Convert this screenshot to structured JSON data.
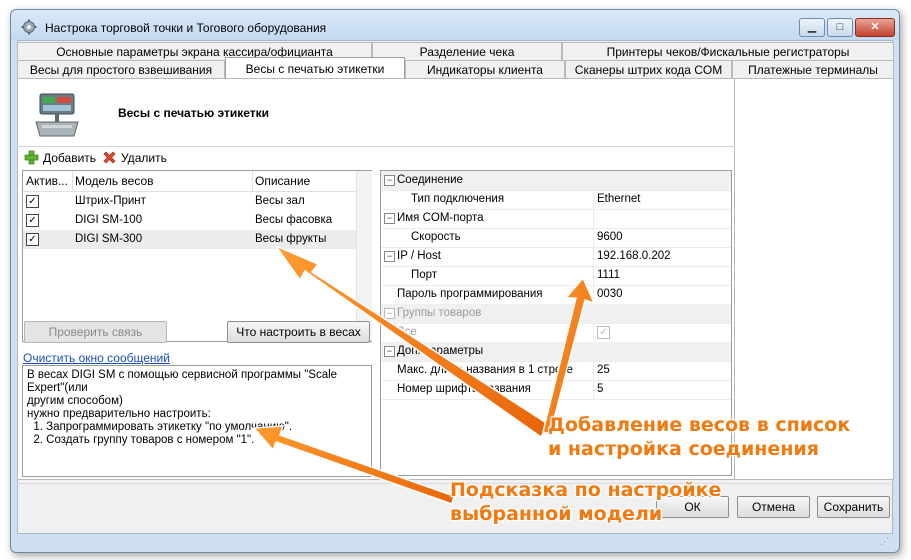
{
  "window": {
    "title": "Настрока торговой точки и Тогового оборудования",
    "min_glyph": "▁",
    "max_glyph": "□",
    "close_glyph": "✕",
    "icon": "gear-icon"
  },
  "tabs": {
    "row1": [
      "Основные параметры экрана кассира/официанта",
      "Разделение чека",
      "Принтеры чеков/Фискальные регистраторы"
    ],
    "row2": [
      "Весы для простого взвешивания",
      "Весы с печатью этикетки",
      "Индикаторы клиента",
      "Сканеры штрих кода COM",
      "Платежные терминалы"
    ],
    "active": "Весы с печатью этикетки"
  },
  "header": {
    "title": "Весы с печатью этикетки",
    "icon": "scale-icon"
  },
  "toolbar": {
    "add_label": "Добавить",
    "delete_label": "Удалить",
    "add_icon": "plus-icon",
    "delete_icon": "delete-icon"
  },
  "scales_list": {
    "columns": [
      "Актив...",
      "Модель весов",
      "Описание"
    ],
    "rows": [
      {
        "active": true,
        "model": "Штрих-Принт",
        "description": "Весы зал"
      },
      {
        "active": true,
        "model": "DIGI SM-100",
        "description": "Весы фасовка"
      },
      {
        "active": true,
        "model": "DIGI SM-300",
        "description": "Весы фрукты"
      }
    ],
    "check_glyph": "✓"
  },
  "buttons": {
    "check_connection": "Проверить связь",
    "what_to_configure": "Что настроить в весах",
    "clear_messages": "Очистить окно сообщений",
    "ok": "ОК",
    "cancel": "Отмена",
    "save": "Сохранить"
  },
  "messages": {
    "lines": [
      "В весах DIGI SM с помощью сервисной программы \"Scale Expert\"(или",
      "другим способом)",
      "нужно предварительно настроить:",
      "  1. Запрограммировать этикетку \"по умолчанию\".",
      "  2. Создать группу товаров с номером \"1\"."
    ]
  },
  "properties": {
    "expand_glyph": "−",
    "connection_category": "Соединение",
    "connection_type_label": "Тип подключения",
    "connection_type_value": "Ethernet",
    "com_port_label": "Имя COM-порта",
    "speed_label": "Скорость",
    "speed_value": "9600",
    "ip_label": "IP / Host",
    "ip_value": "192.168.0.202",
    "port_label": "Порт",
    "port_value": "1111",
    "password_label": "Пароль программирования",
    "password_value": "0030",
    "groups_category": "Группы товаров",
    "all_label": "Все",
    "extra_category": "Доп. параметры",
    "max_name_label": "Макс. длина названия в 1 строке",
    "max_name_value": "25",
    "font_label": "Номер шрифта названия",
    "font_value": "5"
  },
  "annotations": {
    "callout1_line1": "Добавление весов в список",
    "callout1_line2": "и настройка соединения",
    "callout2_line1": "Подсказка по настройке",
    "callout2_line2": "выбранной модели",
    "color": "#f07a10"
  }
}
